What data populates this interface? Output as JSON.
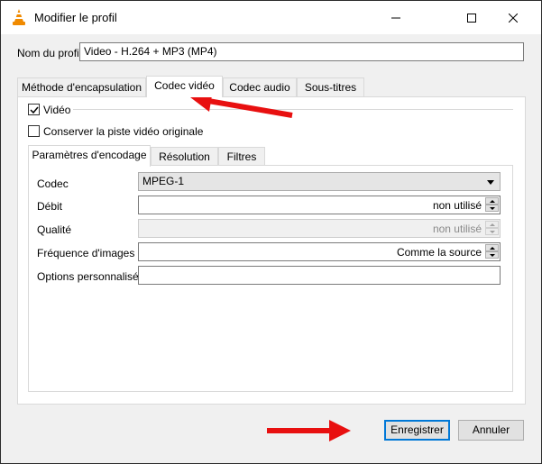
{
  "window": {
    "title": "Modifier le profil",
    "controls": [
      "minimize",
      "maximize",
      "close"
    ]
  },
  "profile": {
    "name_label": "Nom du profil",
    "name_value": "Video - H.264 + MP3 (MP4)"
  },
  "tabs": [
    {
      "label": "Méthode d'encapsulation",
      "active": false
    },
    {
      "label": "Codec vidéo",
      "active": true
    },
    {
      "label": "Codec audio",
      "active": false
    },
    {
      "label": "Sous-titres",
      "active": false
    }
  ],
  "video": {
    "enable_label": "Vidéo",
    "enable_checked": true,
    "keep_original_label": "Conserver la piste vidéo originale",
    "keep_original_checked": false
  },
  "subtabs": [
    {
      "label": "Paramètres d'encodage",
      "active": true
    },
    {
      "label": "Résolution",
      "active": false
    },
    {
      "label": "Filtres",
      "active": false
    }
  ],
  "encoding": {
    "codec_label": "Codec",
    "codec_value": "MPEG-1",
    "bitrate_label": "Débit",
    "bitrate_value": "non utilisé",
    "quality_label": "Qualité",
    "quality_value": "non utilisé",
    "framerate_label": "Fréquence d'images",
    "framerate_value": "Comme la source",
    "custom_options_label": "Options personnalisés",
    "custom_options_value": ""
  },
  "footer": {
    "save_label": "Enregistrer",
    "cancel_label": "Annuler"
  },
  "annotation": {
    "arrow_color": "#e81010"
  }
}
